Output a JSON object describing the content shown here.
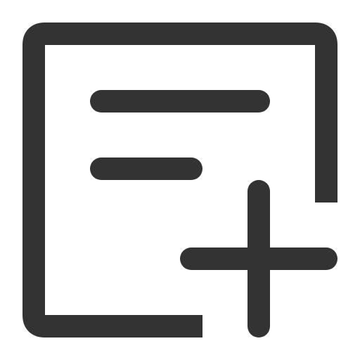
{
  "icon": {
    "name": "add-note-icon",
    "stroke_color": "#333333",
    "background_color": "#ffffff"
  }
}
